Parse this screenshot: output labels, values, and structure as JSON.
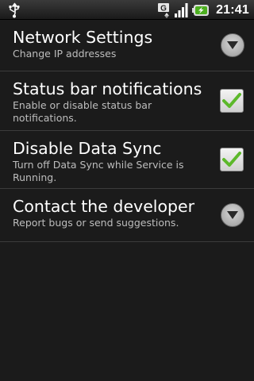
{
  "status_bar": {
    "time": "21:41",
    "network_letter": "G",
    "icons": [
      "usb-icon",
      "gprs-icon",
      "signal-icon",
      "battery-charging-icon"
    ]
  },
  "preferences": [
    {
      "title": "Network Settings",
      "summary": "Change IP addresses",
      "widget": "chevron-down-icon"
    },
    {
      "title": "Status bar notifications",
      "summary": "Enable or disable status bar notifications.",
      "widget": "checkbox",
      "checked": true
    },
    {
      "title": "Disable Data Sync",
      "summary": "Turn off Data Sync while Service is Running.",
      "widget": "checkbox",
      "checked": true
    },
    {
      "title": "Contact the developer",
      "summary": "Report bugs or send suggestions.",
      "widget": "chevron-down-icon"
    }
  ],
  "colors": {
    "background": "#1b1b1b",
    "title_text": "#ffffff",
    "summary_text": "#bdbdbd",
    "divider": "#3c3c3c",
    "checkmark": "#5cb82a"
  }
}
